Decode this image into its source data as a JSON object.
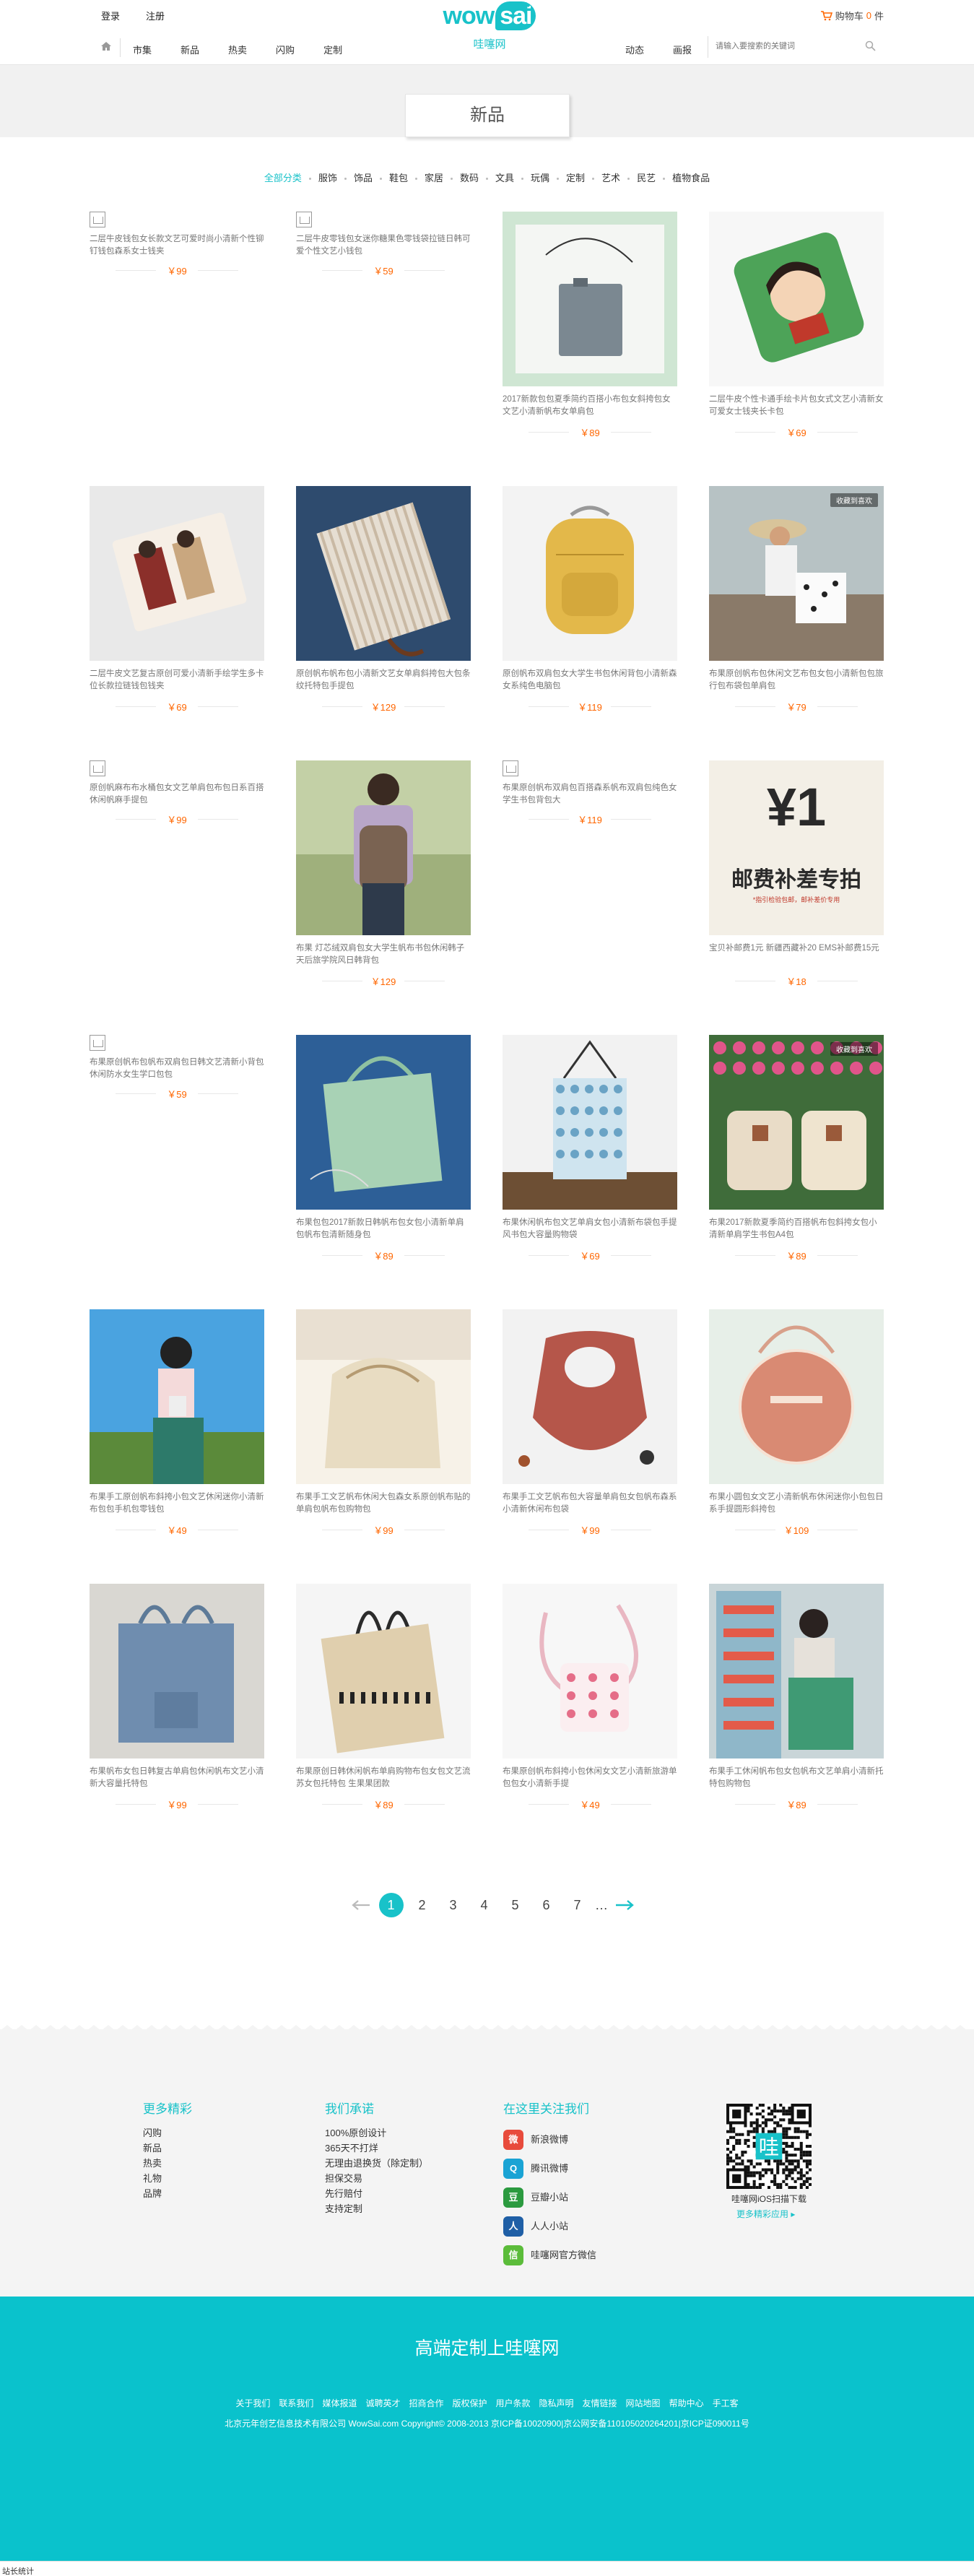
{
  "header": {
    "login": "登录",
    "register": "注册",
    "cart_label": "购物车",
    "cart_count": "0",
    "cart_unit": "件",
    "logo_text": "wow",
    "logo_text2": "sai",
    "logo_cn": "哇噻网",
    "nav_left": [
      "市集",
      "新品",
      "热卖",
      "闪购",
      "定制"
    ],
    "nav_right": [
      "动态",
      "画报"
    ],
    "search_placeholder": "请输入要搜索的关键词"
  },
  "page": {
    "title": "新品",
    "categories": [
      "全部分类",
      "服饰",
      "饰品",
      "鞋包",
      "家居",
      "数码",
      "文具",
      "玩偶",
      "定制",
      "艺术",
      "民艺",
      "植物食品"
    ],
    "active_category": "全部分类"
  },
  "products": [
    {
      "desc": "二层牛皮钱包女长款文艺可爱时尚小清新个性铆钉钱包森系女士钱夹",
      "price": "￥99",
      "image": "placeholder",
      "tag": ""
    },
    {
      "desc": "二层牛皮零钱包女迷你糖果色零钱袋拉链日韩可爱个性文艺小钱包",
      "price": "￥59",
      "image": "placeholder",
      "tag": ""
    },
    {
      "desc": "2017新款包包夏季简约百搭小布包女斜挎包女文艺小清新帆布女单肩包",
      "price": "￥89",
      "image": "gray-crossbody-bag",
      "tag": ""
    },
    {
      "desc": "二层牛皮个性卡通手绘卡片包女式文艺小清新女可爱女士钱夹长卡包",
      "price": "￥69",
      "image": "green-cartoon-wallet",
      "tag": ""
    },
    {
      "desc": "二层牛皮文艺复古原创可爱小清新手绘学生多卡位长款拉链钱包钱夹",
      "price": "￥69",
      "image": "painted-wallet",
      "tag": ""
    },
    {
      "desc": "原创帆布帆布包小清新文艺女单肩斜挎包大包条纹托特包手提包",
      "price": "￥129",
      "image": "striped-tote",
      "tag": ""
    },
    {
      "desc": "原创帆布双肩包女大学生书包休闲背包小清新森女系纯色电脑包",
      "price": "￥119",
      "image": "yellow-backpack",
      "tag": ""
    },
    {
      "desc": "布果原创帆布包休闲文艺布包女包小清新包包旅行包布袋包单肩包",
      "price": "￥79",
      "image": "beach-girl-bag",
      "tag": "收藏到喜欢"
    },
    {
      "desc": "原创帆麻布布水桶包女文艺单肩包布包日系百搭休闲帆麻手提包",
      "price": "￥99",
      "image": "placeholder",
      "tag": ""
    },
    {
      "desc": "布果 灯芯绒双肩包女大学生帆布书包休闲韩子天后旅学院风日韩背包",
      "price": "￥129",
      "image": "girl-backpack",
      "tag": ""
    },
    {
      "desc": "布果原创帆布双肩包百搭森系帆布双肩包纯色女学生书包背包大",
      "price": "￥119",
      "image": "placeholder",
      "tag": ""
    },
    {
      "desc": "宝贝补邮费1元 新疆西藏补20 EMS补邮费15元",
      "price": "￥18",
      "image": "shipping-banner",
      "tag": ""
    },
    {
      "desc": "布果原创帆布包帆布双肩包日韩文艺清新小背包休闲防水女生学口包包",
      "price": "￥59",
      "image": "placeholder",
      "tag": ""
    },
    {
      "desc": "布果包包2017新款日韩帆布包女包小清新单肩包帆布包清新随身包",
      "price": "￥89",
      "image": "mint-tote",
      "tag": ""
    },
    {
      "desc": "布果休闲帆布包文艺单肩女包小清新布袋包手提风书包大容量购物袋",
      "price": "￥69",
      "image": "floral-tote",
      "tag": ""
    },
    {
      "desc": "布果2017新款夏季简约百搭帆布包斜挎女包小清新单肩学生书包A4包",
      "price": "￥89",
      "image": "twin-bags-flowers",
      "tag": "收藏到喜欢"
    },
    {
      "desc": "布果手工原创帆布斜挎小包文艺休闲迷你小清新布包包手机包零钱包",
      "price": "￥49",
      "image": "girl-field",
      "tag": ""
    },
    {
      "desc": "布果手工文艺帆布休闲大包森女系原创帆布贴的单肩包帆布包购物包",
      "price": "￥99",
      "image": "beige-bag",
      "tag": ""
    },
    {
      "desc": "布果手工文艺帆布包大容量单肩包女包帆布森系小清新休闲布包袋",
      "price": "￥99",
      "image": "red-hobo",
      "tag": ""
    },
    {
      "desc": "布果小圆包女文艺小清新帆布休闲迷你小包包日系手提圆形斜挎包",
      "price": "￥109",
      "image": "round-bag",
      "tag": ""
    },
    {
      "desc": "布果帆布女包日韩复古单肩包休闲帆布文艺小清新大容量托特包",
      "price": "￥99",
      "image": "blue-tote",
      "tag": ""
    },
    {
      "desc": "布果原创日韩休闲帆布单肩购物布包女包文艺流苏女包托特包 生果果团款",
      "price": "￥89",
      "image": "tassel-tote",
      "tag": ""
    },
    {
      "desc": "布果原创帆布斜挎小包休闲女文艺小清新旅游单包包女小清新手提",
      "price": "￥49",
      "image": "flamingo-pouch",
      "tag": ""
    },
    {
      "desc": "布果手工休闲帆布包女包帆布文艺单肩小清新托特包购物包",
      "price": "￥89",
      "image": "girl-green-tote",
      "tag": ""
    }
  ],
  "banner": {
    "big": "¥1",
    "line": "邮费补差专拍",
    "note": "*指引检验包邮，邮补差价专用"
  },
  "pager": {
    "pages": [
      "1",
      "2",
      "3",
      "4",
      "5",
      "6",
      "7"
    ],
    "current": "1",
    "ellipsis": "…"
  },
  "footer": {
    "col1_title": "更多精彩",
    "col1": [
      "闪购",
      "新品",
      "热卖",
      "礼物",
      "品牌"
    ],
    "col2_title": "我们承诺",
    "col2": [
      "100%原创设计",
      "365天不打烊",
      "无理由退换货（除定制）",
      "担保交易",
      "先行赔付",
      "支持定制"
    ],
    "col3_title": "在这里关注我们",
    "col3": [
      "新浪微博",
      "腾讯微博",
      "豆瓣小站",
      "人人小站",
      "哇噻网官方微信"
    ],
    "qr_char": "哇",
    "qr_caption": "哇噻网iOS扫描下载",
    "qr_more": "更多精彩应用",
    "slogan": "高端定制上哇噻网",
    "links": [
      "关于我们",
      "联系我们",
      "媒体报道",
      "诚聘英才",
      "招商合作",
      "版权保护",
      "用户条款",
      "隐私声明",
      "友情链接",
      "网站地图",
      "帮助中心",
      "手工客"
    ],
    "copyright": "北京元年创艺信息技术有限公司 WowSai.com Copyright© 2008-2013 京ICP备10020900|京公网安备110105020264201|京ICP证090011号"
  },
  "status_bar": "站长统计",
  "colors": {
    "accent": "#18c2c9",
    "price": "#ff6600",
    "footer_bg": "#0ac2cc"
  }
}
